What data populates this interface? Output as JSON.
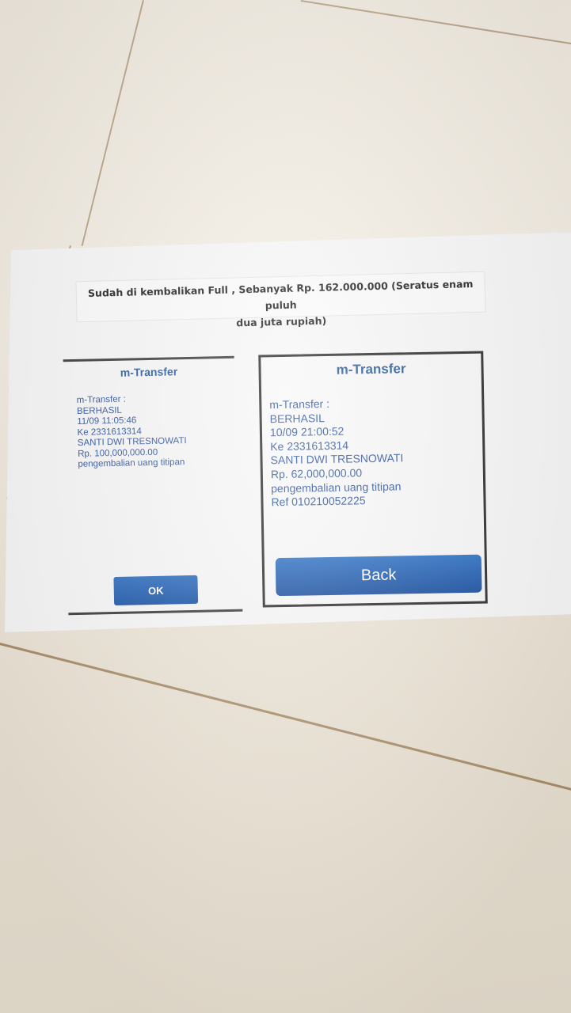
{
  "header": {
    "line1": "Sudah di kembalikan Full , Sebanyak Rp. 162.000.000 (Seratus enam puluh",
    "line2": "dua juta rupiah)"
  },
  "left_receipt": {
    "title": "m-Transfer",
    "lines": [
      "m-Transfer :",
      "BERHASIL",
      "11/09 11:05:46",
      "Ke 2331613314",
      "SANTI DWI TRESNOWATI",
      "Rp. 100,000,000.00",
      "pengembalian uang titipan"
    ],
    "button_label": "OK"
  },
  "right_receipt": {
    "title": "m-Transfer",
    "lines": [
      "m-Transfer :",
      "BERHASIL",
      "10/09 21:00:52",
      "Ke 2331613314",
      "SANTI DWI TRESNOWATI",
      "Rp. 62,000,000.00",
      "pengembalian uang titipan",
      "Ref 010210052225"
    ],
    "button_label": "Back"
  },
  "colors": {
    "text_blue": "#2d55a0",
    "button_blue": "#1b54a6",
    "floor": "#efe9de",
    "paper": "#f7f7f8"
  }
}
